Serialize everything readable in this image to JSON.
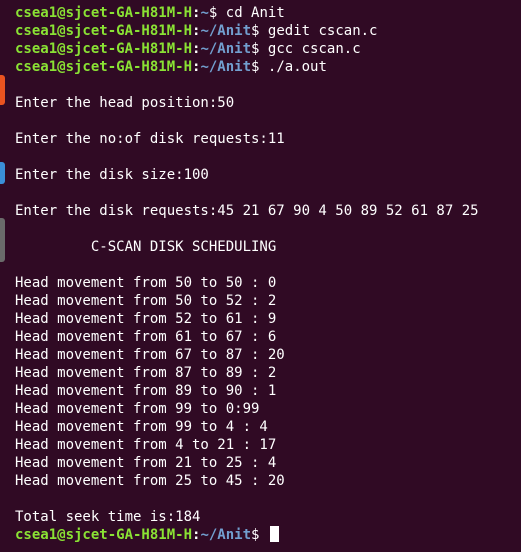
{
  "prompt": {
    "user_host": "csea1@sjcet-GA-H81M-H",
    "separator": ":",
    "home_path": "~",
    "anit_path": "~/Anit",
    "dollar": "$"
  },
  "commands": {
    "cmd1": "cd Anit",
    "cmd2": "gedit cscan.c",
    "cmd3": "gcc cscan.c",
    "cmd4": "./a.out"
  },
  "output": {
    "head_position": "Enter the head position:50",
    "num_requests": "Enter the no:of disk requests:11",
    "disk_size": "Enter the disk size:100",
    "disk_requests": "Enter the disk requests:45 21 67 90 4 50 89 52 61 87 25",
    "scheduling_title": "C-SCAN DISK SCHEDULING",
    "movements": [
      "Head movement from 50 to 50 : 0",
      "Head movement from 50 to 52 : 2",
      "Head movement from 52 to 61 : 9",
      "Head movement from 61 to 67 : 6",
      "Head movement from 67 to 87 : 20",
      "Head movement from 87 to 89 : 2",
      "Head movement from 89 to 90 : 1",
      "Head movement from 99 to 0:99",
      "Head movement from 99 to 4 : 4",
      "Head movement from 4 to 21 : 17",
      "Head movement from 21 to 25 : 4",
      "Head movement from 25 to 45 : 20"
    ],
    "total_seek": "Total seek time is:184"
  },
  "colors": {
    "background": "#300a24",
    "user_host": "#8ae234",
    "path": "#729fcf",
    "text": "#ffffff"
  }
}
